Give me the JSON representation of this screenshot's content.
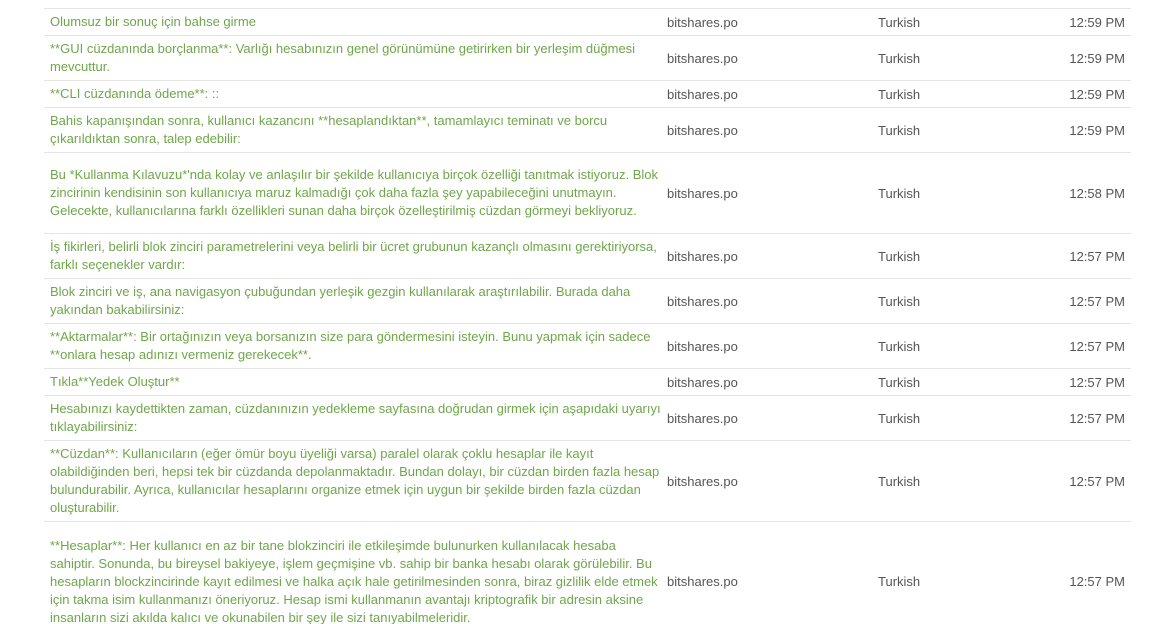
{
  "rows": [
    {
      "message": "",
      "user": "",
      "language": "",
      "time": ""
    },
    {
      "message": "Olumsuz bir sonuç için bahse girme",
      "user": "bitshares.po",
      "language": "Turkish",
      "time": "12:59 PM"
    },
    {
      "message": "**GUI cüzdanında borçlanma**: Varlığı hesabınızın genel görünümüne getirirken bir yerleşim düğmesi mevcuttur.",
      "user": "bitshares.po",
      "language": "Turkish",
      "time": "12:59 PM"
    },
    {
      "message": "**CLI cüzdanında ödeme**: ::",
      "user": "bitshares.po",
      "language": "Turkish",
      "time": "12:59 PM"
    },
    {
      "message": "Bahis kapanışından sonra, kullanıcı kazancını **hesaplandıktan**, tamamlayıcı teminatı ve borcu çıkarıldıktan sonra, talep edebilir:",
      "user": "bitshares.po",
      "language": "Turkish",
      "time": "12:59 PM"
    },
    {
      "message": "Bu *Kullanma Kılavuzu*'nda kolay ve anlaşılır bir şekilde kullanıcıya birçok özelliği tanıtmak istiyoruz. Blok zincirinin kendisinin son kullanıcıya maruz kalmadığı çok daha fazla şey yapabileceğini unutmayın. Gelecekte, kullanıcılarına farklı özellikleri sunan daha birçok özelleştirilmiş cüzdan görmeyi bekliyoruz.",
      "user": "bitshares.po",
      "language": "Turkish",
      "time": "12:58 PM"
    },
    {
      "message": "İş fikirleri, belirli blok zinciri parametrelerini veya belirli bir ücret grubunun kazançlı olmasını gerektiriyorsa, farklı seçenekler vardır:",
      "user": "bitshares.po",
      "language": "Turkish",
      "time": "12:57 PM"
    },
    {
      "message": "Blok zinciri ve iş, ana navigasyon çubuğundan yerleşik gezgin kullanılarak araştırılabilir. Burada daha yakından bakabilirsiniz:",
      "user": "bitshares.po",
      "language": "Turkish",
      "time": "12:57 PM"
    },
    {
      "message": "**Aktarmalar**: Bir ortağınızın veya borsanızın size para göndermesini isteyin. Bunu yapmak için sadece **onlara hesap adınızı vermeniz gerekecek**.",
      "user": "bitshares.po",
      "language": "Turkish",
      "time": "12:57 PM"
    },
    {
      "message": "Tıkla**Yedek Oluştur**",
      "user": "bitshares.po",
      "language": "Turkish",
      "time": "12:57 PM"
    },
    {
      "message": "Hesabınızı kaydettikten zaman, cüzdanınızın yedekleme sayfasına doğrudan girmek için aşapıdaki uyarıyı tıklayabilirsiniz:",
      "user": "bitshares.po",
      "language": "Turkish",
      "time": "12:57 PM"
    },
    {
      "message": "**Cüzdan**: Kullanıcıların (eğer ömür boyu üyeliği varsa) paralel olarak çoklu hesaplar ile kayıt olabildiğinden beri, hepsi tek bir cüzdanda depolanmaktadır. Bundan dolayı, bir cüzdan birden fazla hesap bulundurabilir. Ayrıca, kullanıcılar hesaplarını organize etmek için uygun bir şekilde birden fazla cüzdan oluşturabilir.",
      "user": "bitshares.po",
      "language": "Turkish",
      "time": "12:57 PM"
    },
    {
      "message": "**Hesaplar**: Her kullanıcı en az bir tane blokzinciri ile etkileşimde bulunurken kullanılacak hesaba sahiptir. Sonunda, bu bireysel bakiyeye, işlem geçmişine vb. sahip bir banka hesabı olarak görülebilir. Bu hesapların blockzincirinde kayıt edilmesi ve halka açık hale getirilmesinden sonra, biraz gizlilik elde etmek için takma isim kullanmanızı öneriyoruz. Hesap ismi kullanmanın avantajı kriptografik bir adresin aksine insanların sizi akılda kalıcı ve okunabilen bir şey ile sizi tanıyabilmeleridir.",
      "user": "bitshares.po",
      "language": "Turkish",
      "time": "12:57 PM"
    }
  ]
}
